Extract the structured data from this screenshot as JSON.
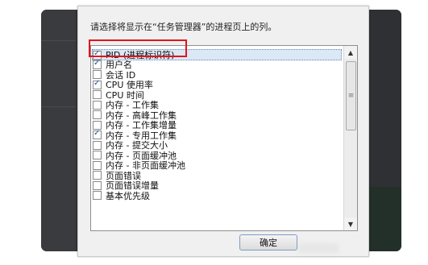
{
  "dialog": {
    "description": "请选择将显示在“任务管理器”的进程页上的列。",
    "columns": [
      {
        "label": "PID (进程标识符)",
        "checked": true
      },
      {
        "label": "用户名",
        "checked": true
      },
      {
        "label": "会话 ID",
        "checked": false
      },
      {
        "label": "CPU 使用率",
        "checked": true
      },
      {
        "label": "CPU 时间",
        "checked": false
      },
      {
        "label": "内存 - 工作集",
        "checked": false
      },
      {
        "label": "内存 - 高峰工作集",
        "checked": false
      },
      {
        "label": "内存 - 工作集增量",
        "checked": false
      },
      {
        "label": "内存 - 专用工作集",
        "checked": true
      },
      {
        "label": "内存 - 提交大小",
        "checked": false
      },
      {
        "label": "内存 - 页面缓冲池",
        "checked": false
      },
      {
        "label": "内存 - 非页面缓冲池",
        "checked": false
      },
      {
        "label": "页面错误",
        "checked": false
      },
      {
        "label": "页面错误增量",
        "checked": false
      },
      {
        "label": "基本优先级",
        "checked": false
      }
    ],
    "ok_label": "确定"
  },
  "colors": {
    "highlight_border": "#e0141a",
    "check_mark": "#1e4fa3"
  }
}
